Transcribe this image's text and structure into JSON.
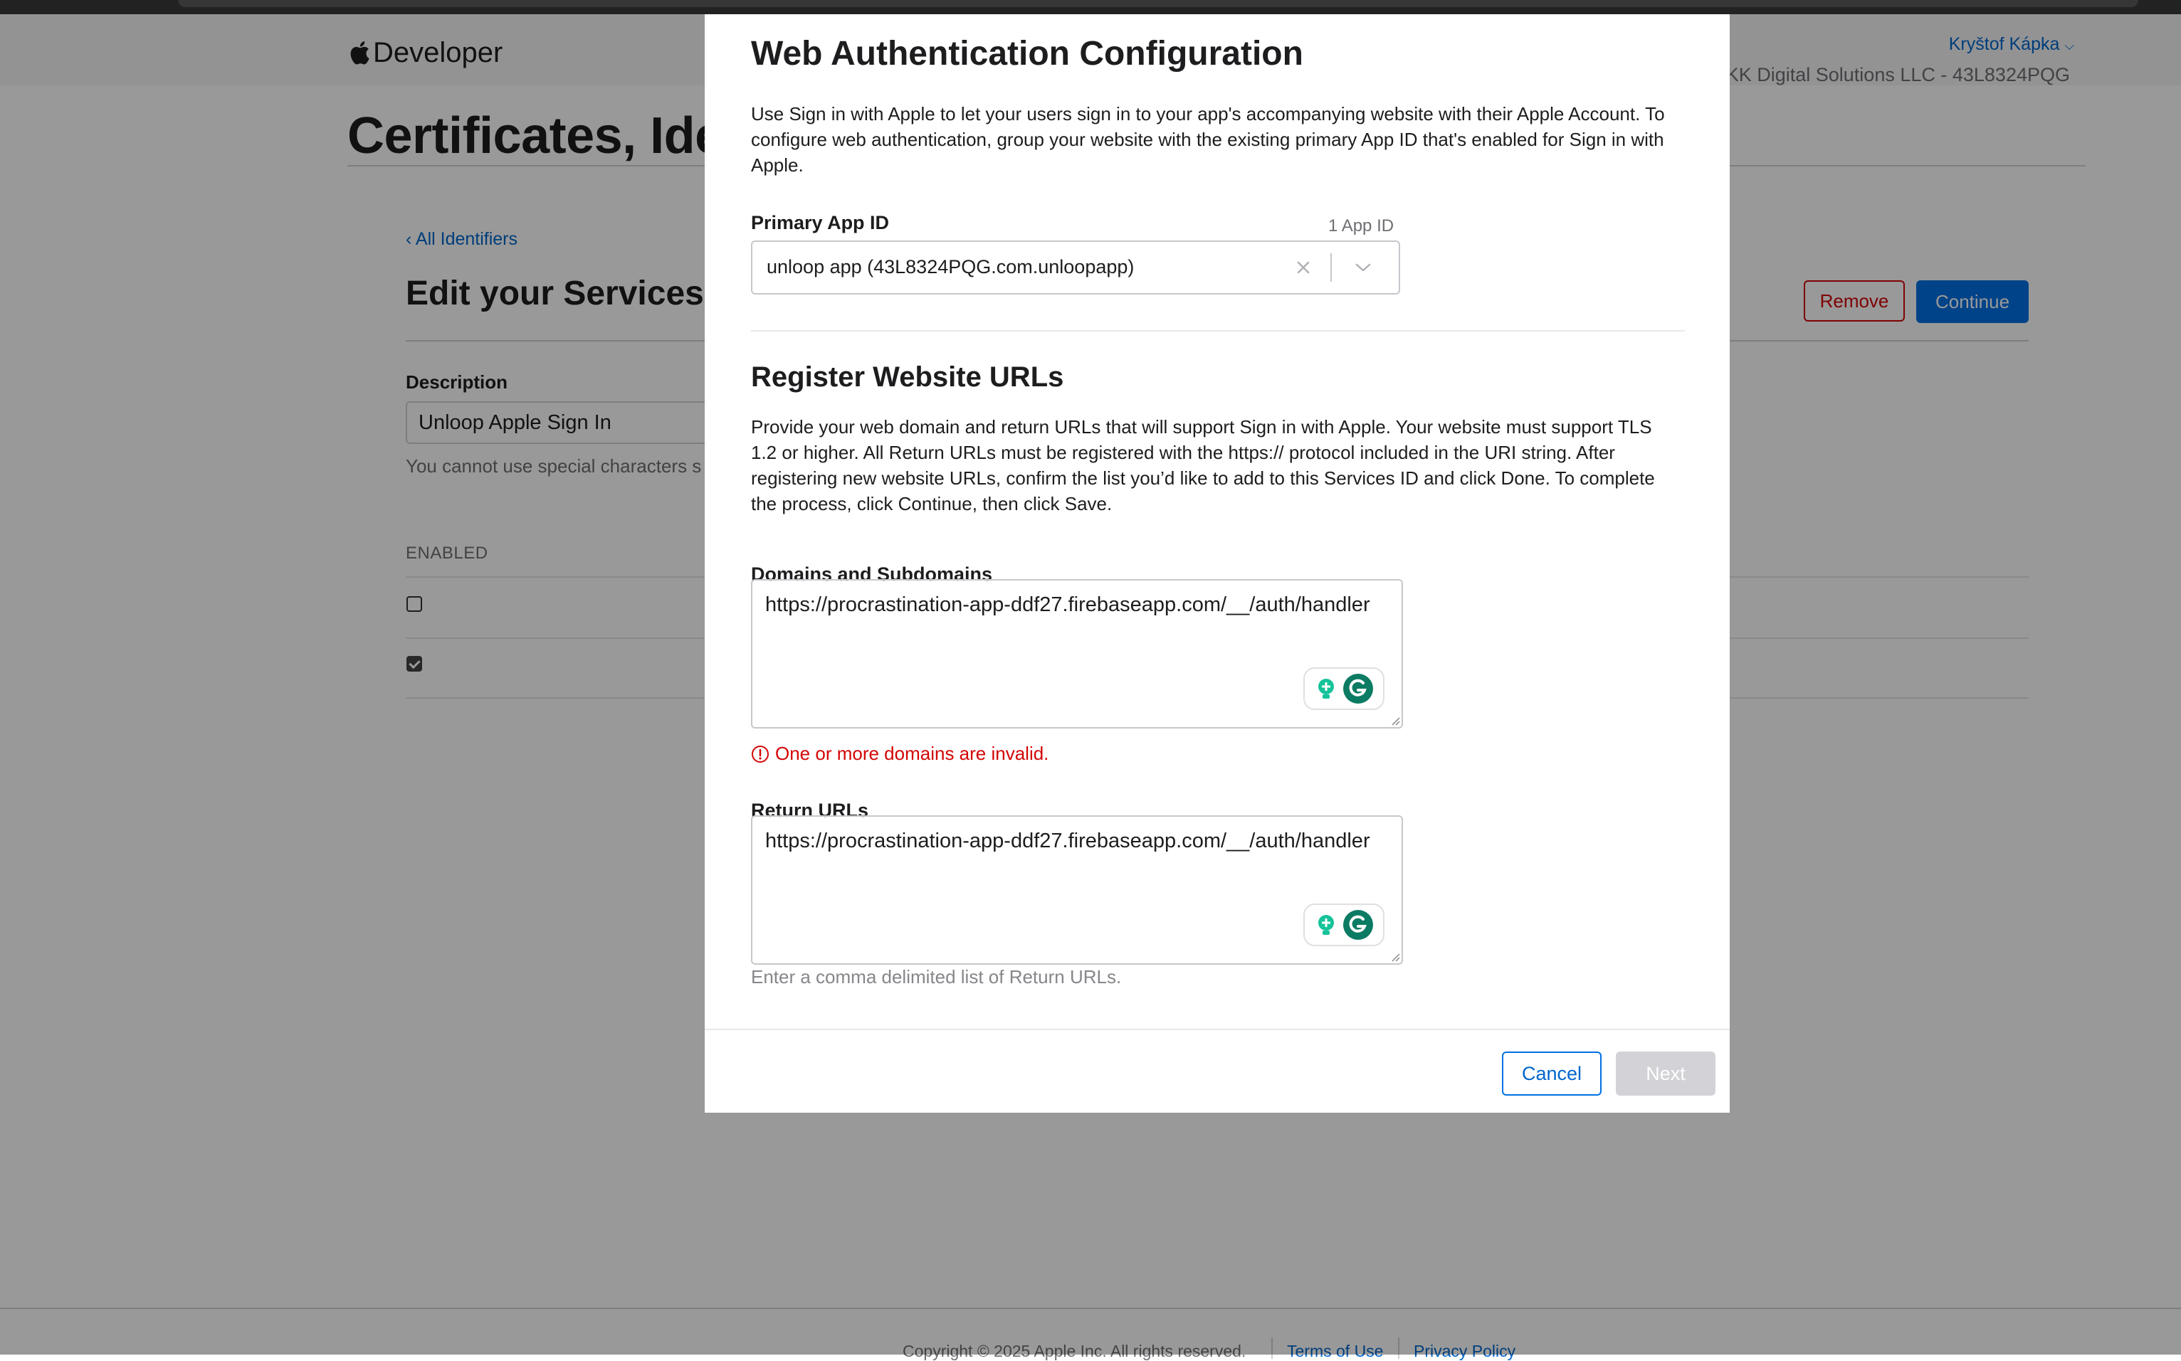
{
  "nav": {
    "logo_text": "Developer",
    "account_name": "Kryštof Kápka",
    "team": "KK Digital Solutions LLC - 43L8324PQG"
  },
  "page": {
    "title": "Certificates, Ide",
    "back_link": "‹ All Identifiers",
    "section_title": "Edit your Services",
    "remove_label": "Remove",
    "continue_label": "Continue",
    "description_label": "Description",
    "description_value": "Unloop Apple Sign In",
    "description_help": "You cannot use special characters s",
    "enabled_header": "ENABLED",
    "checkboxes": [
      false,
      true
    ]
  },
  "footer": {
    "copyright": "Copyright © 2025 Apple Inc. All rights reserved.",
    "terms": "Terms of Use",
    "privacy": "Privacy Policy"
  },
  "modal": {
    "title": "Web Authentication Configuration",
    "intro": "Use Sign in with Apple to let your users sign in to your app's accompanying website with their Apple Account. To configure web authentication, group your website with the existing primary App ID that's enabled for Sign in with Apple.",
    "primary_app_id_label": "Primary App ID",
    "primary_app_id_count": "1 App ID",
    "primary_app_id_value": "unloop app (43L8324PQG.com.unloopapp)",
    "register_title": "Register Website URLs",
    "register_text": "Provide your web domain and return URLs that will support Sign in with Apple. Your website must support TLS 1.2 or higher. All Return URLs must be registered with the https:// protocol included in the URI string. After registering new website URLs, confirm the list you’d like to add to this Services ID and click Done. To complete the process, click Continue, then click Save.",
    "domains_label": "Domains and Subdomains",
    "domains_value": "https://procrastination-app-ddf27.firebaseapp.com/__/auth/handler",
    "domains_error": "One or more domains are invalid.",
    "return_urls_label": "Return URLs",
    "return_urls_value": "https://procrastination-app-ddf27.firebaseapp.com/__/auth/handler",
    "return_urls_hint": "Enter a comma delimited list of Return URLs.",
    "cancel_label": "Cancel",
    "next_label": "Next"
  },
  "colors": {
    "link": "#0066cc",
    "primary_button": "#0071e3",
    "error": "#d30505",
    "grammarly": "#15c39a"
  }
}
